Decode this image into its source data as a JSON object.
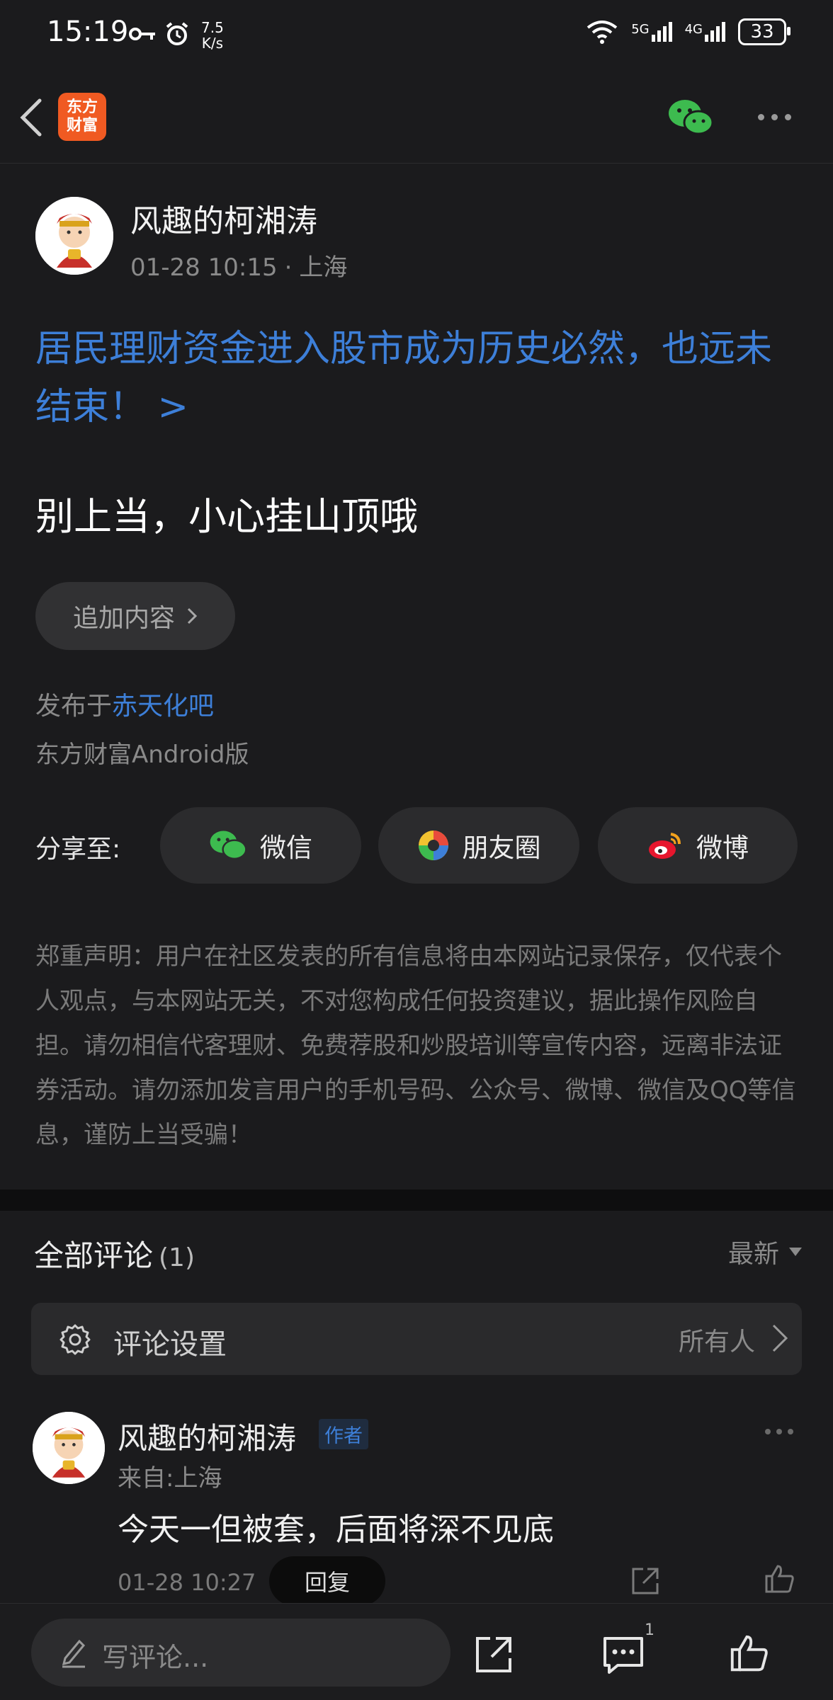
{
  "status_bar": {
    "time": "15:19",
    "net_speed": "7.5\nK/s",
    "net_speed_top": "7.5",
    "net_speed_bottom": "K/s",
    "signal_1": "5G",
    "signal_2": "4G",
    "battery": "33"
  },
  "app": {
    "logo_line1": "东方",
    "logo_line2": "财富"
  },
  "post": {
    "author": "风趣的柯湘涛",
    "time": "01-28 10:15",
    "dot": "·",
    "location": "上海",
    "title": "居民理财资金进入股市成为历史必然，也远未结束！ >",
    "body": "别上当，小心挂山顶哦",
    "add_content_label": "追加内容",
    "posted_in_prefix": "发布于",
    "bar_name": "赤天化吧",
    "client": "东方财富Android版"
  },
  "share": {
    "label": "分享至:",
    "options": [
      {
        "label": "微信",
        "icon": "wechat-icon"
      },
      {
        "label": "朋友圈",
        "icon": "moments-icon"
      },
      {
        "label": "微博",
        "icon": "weibo-icon"
      }
    ]
  },
  "disclaimer": "郑重声明：用户在社区发表的所有信息将由本网站记录保存，仅代表个人观点，与本网站无关，不对您构成任何投资建议，据此操作风险自担。请勿相信代客理财、免费荐股和炒股培训等宣传内容，远离非法证券活动。请勿添加发言用户的手机号码、公众号、微博、微信及QQ等信息，谨防上当受骗！",
  "comments": {
    "title": "全部评论",
    "count": "(1)",
    "sort_label": "最新",
    "settings_label": "评论设置",
    "settings_value": "所有人",
    "items": [
      {
        "author": "风趣的柯湘涛",
        "badge": "作者",
        "location": "来自:上海",
        "text": "今天一但被套，后面将深不见底",
        "time": "01-28 10:27",
        "reply_label": "回复"
      }
    ]
  },
  "bottom_bar": {
    "input_placeholder": "写评论...",
    "comment_count": "1"
  },
  "colors": {
    "background": "#1b1b1d",
    "link_blue": "#3d7fd8",
    "brand_orange": "#f05a22",
    "wechat_green": "#3dbb4f"
  }
}
